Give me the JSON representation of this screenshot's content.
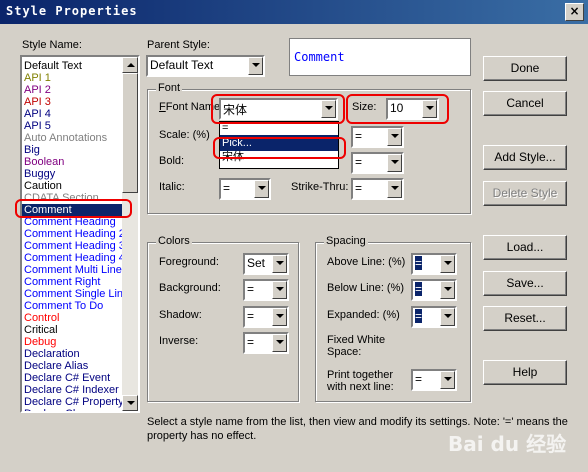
{
  "window": {
    "title": "Style Properties",
    "close": "×"
  },
  "style_list": {
    "label": "Style Name:",
    "items": [
      {
        "t": "Default Text",
        "c": "#000000"
      },
      {
        "t": "API 1",
        "c": "#808000"
      },
      {
        "t": "API 2",
        "c": "#800080"
      },
      {
        "t": "API 3",
        "c": "#c00000"
      },
      {
        "t": "API 4",
        "c": "#000080"
      },
      {
        "t": "API 5",
        "c": "#000080"
      },
      {
        "t": "Auto Annotations",
        "c": "#808080"
      },
      {
        "t": "Big",
        "c": "#000080"
      },
      {
        "t": "Boolean",
        "c": "#800080"
      },
      {
        "t": "Buggy",
        "c": "#000080"
      },
      {
        "t": "Caution",
        "c": "#000000"
      },
      {
        "t": "CDATA Section",
        "c": "#808080"
      },
      {
        "t": "Comment",
        "c": "#ffffff",
        "selected": true
      },
      {
        "t": "Comment Heading",
        "c": "#0000ff"
      },
      {
        "t": "Comment Heading 2",
        "c": "#0000ff"
      },
      {
        "t": "Comment Heading 3",
        "c": "#0000ff"
      },
      {
        "t": "Comment Heading 4",
        "c": "#0000ff"
      },
      {
        "t": "Comment Multi Line",
        "c": "#0000ff"
      },
      {
        "t": "Comment Right",
        "c": "#0000ff"
      },
      {
        "t": "Comment Single Line",
        "c": "#0000ff"
      },
      {
        "t": "Comment To Do",
        "c": "#0000ff"
      },
      {
        "t": "Control",
        "c": "#ff0000"
      },
      {
        "t": "Critical",
        "c": "#000000"
      },
      {
        "t": "Debug",
        "c": "#ff0000"
      },
      {
        "t": "Declaration",
        "c": "#000080"
      },
      {
        "t": "Declare Alias",
        "c": "#000080"
      },
      {
        "t": "Declare C# Event",
        "c": "#000080"
      },
      {
        "t": "Declare C# Indexer",
        "c": "#000080"
      },
      {
        "t": "Declare C# Property",
        "c": "#000080"
      },
      {
        "t": "Declare Class",
        "c": "#000080"
      }
    ]
  },
  "parent_style": {
    "label": "Parent Style:",
    "value": "Default Text"
  },
  "preview": {
    "text": "Comment"
  },
  "font": {
    "group_label": "Font",
    "name_label": "Font Name:",
    "name_value": "宋体",
    "size_label": "Size:",
    "size_value": "10",
    "scale_label": "Scale: (%)",
    "bold_label": "Bold:",
    "italic_label": "Italic:",
    "strike_label": "Strike-Thru:",
    "eq": "=",
    "dropdown": [
      "=",
      "Pick...",
      "宋体"
    ]
  },
  "colors": {
    "group_label": "Colors",
    "foreground_label": "Foreground:",
    "foreground_value": "Set",
    "background_label": "Background:",
    "background_value": "=",
    "shadow_label": "Shadow:",
    "shadow_value": "=",
    "inverse_label": "Inverse:",
    "inverse_value": "="
  },
  "spacing": {
    "group_label": "Spacing",
    "above_label": "Above Line: (%)",
    "above_value": "=",
    "below_label": "Below Line: (%)",
    "below_value": "=",
    "expanded_label": "Expanded: (%)",
    "expanded_value": "=",
    "fixed_label_1": "Fixed White",
    "fixed_label_2": "Space:",
    "print_label_1": "Print together",
    "print_label_2": "with next line:",
    "print_value": "="
  },
  "buttons": {
    "done": "Done",
    "cancel": "Cancel",
    "add_style": "Add Style...",
    "delete_style": "Delete Style",
    "load": "Load...",
    "save": "Save...",
    "reset": "Reset...",
    "help": "Help"
  },
  "help_text": {
    "line1": "Select a style name from the list, then view and modify its settings. Note: '=' means the",
    "line2": "property has no effect."
  },
  "watermark": "Bai du 经验",
  "colors_theme": {
    "accent": "#0a246a",
    "highlight_mark": "#e00000",
    "face": "#d4d0c8"
  }
}
